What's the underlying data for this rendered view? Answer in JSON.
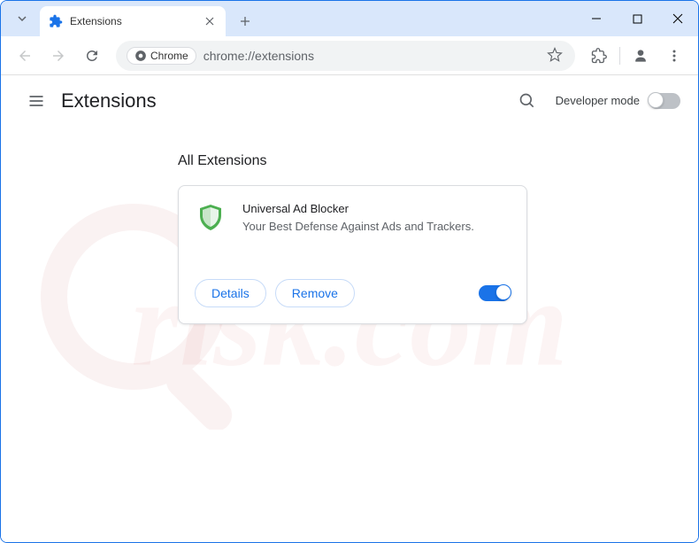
{
  "browser": {
    "tab": {
      "title": "Extensions"
    },
    "url": "chrome://extensions",
    "chip_label": "Chrome"
  },
  "page": {
    "title": "Extensions",
    "dev_mode_label": "Developer mode",
    "section_title": "All Extensions"
  },
  "extension": {
    "name": "Universal Ad Blocker",
    "description": "Your Best Defense Against Ads and Trackers.",
    "details_label": "Details",
    "remove_label": "Remove",
    "enabled": true
  },
  "colors": {
    "accent": "#1a73e8",
    "chrome_bg": "#d9e7fb"
  }
}
